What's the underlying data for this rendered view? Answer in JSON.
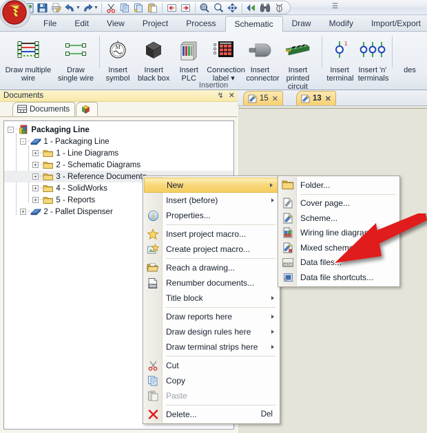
{
  "app": {
    "logo_name": "app-logo"
  },
  "quick_access": {
    "buttons": [
      {
        "name": "new-project-icon",
        "label": "New"
      },
      {
        "name": "save-icon",
        "label": "Save"
      },
      {
        "name": "print-icon",
        "label": "Print"
      },
      {
        "name": "undo-icon",
        "label": "Undo"
      },
      {
        "name": "redo-icon",
        "label": "Redo"
      },
      {
        "name": "cut-icon",
        "label": "Cut"
      },
      {
        "name": "copy-icon",
        "label": "Copy"
      },
      {
        "name": "copy-special-icon",
        "label": "Copy special"
      },
      {
        "name": "paste-icon",
        "label": "Paste"
      },
      {
        "name": "previous-folio-icon",
        "label": "Previous folio"
      },
      {
        "name": "next-folio-icon",
        "label": "Next folio"
      },
      {
        "name": "zoom-window-icon",
        "label": "Zoom window"
      },
      {
        "name": "zoom-icon",
        "label": "Zoom"
      },
      {
        "name": "pan-icon",
        "label": "Pan"
      },
      {
        "name": "navigate-icon",
        "label": "Navigate"
      },
      {
        "name": "binoculars-icon",
        "label": "Find"
      },
      {
        "name": "bug-icon",
        "label": "Diagnostics"
      }
    ],
    "overflow_label": "☰"
  },
  "menu_tabs": [
    {
      "label": "File",
      "active": false
    },
    {
      "label": "Edit",
      "active": false
    },
    {
      "label": "View",
      "active": false
    },
    {
      "label": "Project",
      "active": false
    },
    {
      "label": "Process",
      "active": false
    },
    {
      "label": "Schematic",
      "active": true
    },
    {
      "label": "Draw",
      "active": false
    },
    {
      "label": "Modify",
      "active": false
    },
    {
      "label": "Import/Export",
      "active": false
    }
  ],
  "ribbon": {
    "group_label": "Insertion",
    "items": [
      {
        "label": "Draw multiple wire",
        "icon": "multi-wire-icon"
      },
      {
        "label": "Draw single wire",
        "icon": "single-wire-icon"
      },
      {
        "sep": true
      },
      {
        "label": "Insert symbol",
        "icon": "motor-symbol-icon"
      },
      {
        "label": "Insert black box",
        "icon": "black-box-icon"
      },
      {
        "label": "Insert PLC",
        "icon": "plc-icon"
      },
      {
        "label": "Connection label",
        "icon": "connection-label-icon",
        "dropdown": true
      },
      {
        "label": "Insert connector",
        "icon": "connector-icon"
      },
      {
        "label": "Insert printed circuit board",
        "icon": "pcb-icon"
      },
      {
        "sep": true
      },
      {
        "label": "Insert terminal",
        "icon": "terminal-icon"
      },
      {
        "label": "Insert 'n' terminals",
        "icon": "n-terminals-icon"
      },
      {
        "sep": true
      },
      {
        "label": "des",
        "icon": "design-icon",
        "clipped": true
      }
    ]
  },
  "documents_panel": {
    "title": "Documents",
    "pin_icon": "↯",
    "close_icon": "✕",
    "tabs": [
      {
        "label": "Documents",
        "icon": "documents-tab-icon",
        "active": true
      },
      {
        "label": "",
        "icon": "components-tab-icon",
        "active": false
      }
    ],
    "tree": [
      {
        "indent": 0,
        "label": "Packaging Line",
        "icon": "project-icon",
        "expander": "-",
        "bold": true,
        "selected": false
      },
      {
        "indent": 1,
        "label": "1 - Packaging Line",
        "icon": "book-icon",
        "expander": "-",
        "bold": false,
        "selected": false
      },
      {
        "indent": 2,
        "label": "1 - Line Diagrams",
        "icon": "folder-icon",
        "expander": "+",
        "bold": false,
        "selected": false
      },
      {
        "indent": 2,
        "label": "2 - Schematic Diagrams",
        "icon": "folder-icon",
        "expander": "+",
        "bold": false,
        "selected": false
      },
      {
        "indent": 2,
        "label": "3 - Reference Documents",
        "icon": "folder-icon",
        "expander": "+",
        "bold": false,
        "selected": true
      },
      {
        "indent": 2,
        "label": "4 - SolidWorks",
        "icon": "folder-icon",
        "expander": "+",
        "bold": false,
        "selected": false
      },
      {
        "indent": 2,
        "label": "5 - Reports",
        "icon": "folder-icon",
        "expander": "+",
        "bold": false,
        "selected": false
      },
      {
        "indent": 1,
        "label": "2 - Pallet Dispenser",
        "icon": "book-icon",
        "expander": "+",
        "bold": false,
        "selected": false
      }
    ]
  },
  "editor_tabs": [
    {
      "label": "15",
      "icon": "scheme-icon",
      "close": "✕",
      "current": false
    },
    {
      "label": "13",
      "icon": "scheme-icon",
      "close": "✕",
      "current": true
    }
  ],
  "context_menu": {
    "items": [
      {
        "label": "New",
        "icon": null,
        "submenu": true,
        "highlighted": true,
        "disabled": false
      },
      {
        "label": "Insert (before)",
        "icon": null,
        "submenu": true,
        "highlighted": false,
        "disabled": false
      },
      {
        "label": "Properties...",
        "icon": "info-icon",
        "submenu": false,
        "highlighted": false,
        "disabled": false
      },
      {
        "sep": true
      },
      {
        "label": "Insert project macro...",
        "icon": "star-icon",
        "submenu": false,
        "highlighted": false,
        "disabled": false
      },
      {
        "label": "Create project macro...",
        "icon": "star-add-icon",
        "submenu": false,
        "highlighted": false,
        "disabled": false
      },
      {
        "sep": true
      },
      {
        "label": "Reach a drawing...",
        "icon": "open-folder-icon",
        "submenu": false,
        "highlighted": false,
        "disabled": false
      },
      {
        "label": "Renumber documents...",
        "icon": "numbers-icon",
        "submenu": false,
        "highlighted": false,
        "disabled": false
      },
      {
        "label": "Title block",
        "icon": null,
        "submenu": true,
        "highlighted": false,
        "disabled": false
      },
      {
        "sep": true
      },
      {
        "label": "Draw reports here",
        "icon": null,
        "submenu": true,
        "highlighted": false,
        "disabled": false
      },
      {
        "label": "Draw design rules here",
        "icon": null,
        "submenu": true,
        "highlighted": false,
        "disabled": false
      },
      {
        "label": "Draw terminal strips here",
        "icon": null,
        "submenu": true,
        "highlighted": false,
        "disabled": false
      },
      {
        "sep": true
      },
      {
        "label": "Cut",
        "icon": "cut-icon",
        "submenu": false,
        "highlighted": false,
        "disabled": false
      },
      {
        "label": "Copy",
        "icon": "copy-icon",
        "submenu": false,
        "highlighted": false,
        "disabled": false
      },
      {
        "label": "Paste",
        "icon": "paste-icon",
        "submenu": false,
        "highlighted": false,
        "disabled": true
      },
      {
        "sep": true
      },
      {
        "label": "Delete...",
        "icon": "delete-x-icon",
        "submenu": false,
        "highlighted": false,
        "disabled": false,
        "shortcut": "Del"
      }
    ]
  },
  "new_submenu": {
    "items": [
      {
        "label": "Folder...",
        "icon": "folder-icon"
      },
      {
        "sep": true
      },
      {
        "label": "Cover page...",
        "icon": "cover-page-icon"
      },
      {
        "label": "Scheme...",
        "icon": "scheme-icon"
      },
      {
        "label": "Wiring line diagram...",
        "icon": "wiring-line-diagram-icon"
      },
      {
        "label": "Mixed scheme...",
        "icon": "mixed-scheme-icon"
      },
      {
        "label": "Data files...",
        "icon": "dwg-icon"
      },
      {
        "label": "Data file shortcuts...",
        "icon": "data-file-shortcut-icon"
      }
    ]
  },
  "annotation": {
    "arrow_color": "#e01b1b",
    "name": "red-pointer-arrow"
  }
}
